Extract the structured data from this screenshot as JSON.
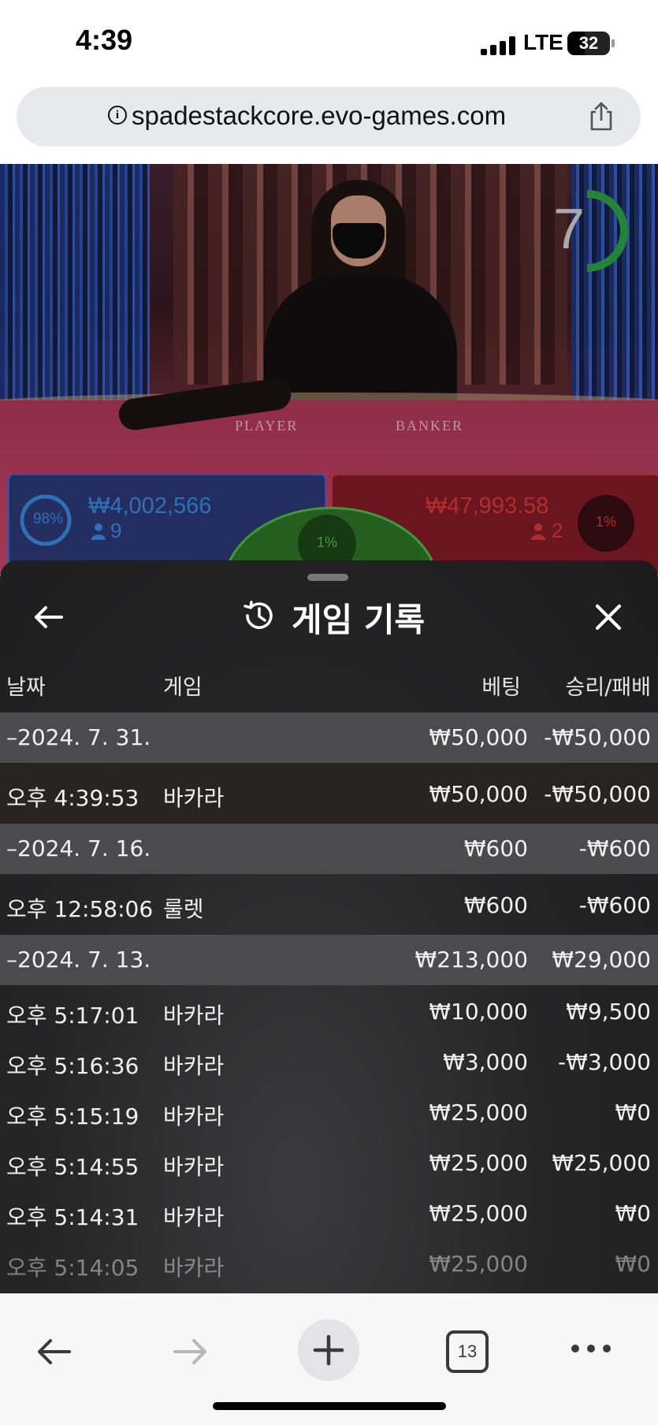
{
  "status_bar": {
    "time": "4:39",
    "network": "LTE",
    "battery": "32"
  },
  "address_bar": {
    "url": "spadestackcore.evo-games.com"
  },
  "game": {
    "timer": "7",
    "felt_player": "PLAYER",
    "felt_banker": "BANKER",
    "player": {
      "percent": "98%",
      "amount": "₩4,002,566",
      "count": "9"
    },
    "banker": {
      "percent": "1%",
      "amount": "₩47,993.58",
      "count": "2"
    },
    "tie": {
      "percent": "1%"
    }
  },
  "history": {
    "title": "게임 기록",
    "columns": {
      "date": "날짜",
      "game": "게임",
      "bet": "베팅",
      "winloss": "승리/패배"
    },
    "rows": [
      {
        "type": "date",
        "date": "–2024. 7. 31.",
        "bet": "₩50,000",
        "winloss": "-₩50,000"
      },
      {
        "type": "item",
        "time": "오후 4:39:53",
        "game": "바카라",
        "bet": "₩50,000",
        "winloss": "-₩50,000"
      },
      {
        "type": "date",
        "date": "–2024. 7. 16.",
        "bet": "₩600",
        "winloss": "-₩600"
      },
      {
        "type": "item",
        "time": "오후 12:58:06",
        "game": "룰렛",
        "bet": "₩600",
        "winloss": "-₩600"
      },
      {
        "type": "date",
        "date": "–2024. 7. 13.",
        "bet": "₩213,000",
        "winloss": "₩29,000"
      },
      {
        "type": "item",
        "time": "오후 5:17:01",
        "game": "바카라",
        "bet": "₩10,000",
        "winloss": "₩9,500"
      },
      {
        "type": "item",
        "time": "오후 5:16:36",
        "game": "바카라",
        "bet": "₩3,000",
        "winloss": "-₩3,000"
      },
      {
        "type": "item",
        "time": "오후 5:15:19",
        "game": "바카라",
        "bet": "₩25,000",
        "winloss": "₩0"
      },
      {
        "type": "item",
        "time": "오후 5:14:55",
        "game": "바카라",
        "bet": "₩25,000",
        "winloss": "₩25,000"
      },
      {
        "type": "item",
        "time": "오후 5:14:31",
        "game": "바카라",
        "bet": "₩25,000",
        "winloss": "₩0"
      },
      {
        "type": "item",
        "time": "오후 5:14:05",
        "game": "바카라",
        "bet": "₩25,000",
        "winloss": "₩0"
      }
    ]
  },
  "toolbar": {
    "tab_count": "13"
  },
  "colors": {
    "player": "#3d8fe8",
    "banker": "#e03a3a",
    "tie": "#53c44a",
    "sheet_bg": "#1f1f20",
    "date_row": "#4b4b4d"
  },
  "icons": [
    "info-icon",
    "share-icon",
    "back-arrow-icon",
    "history-icon",
    "close-icon",
    "user-icon",
    "plus-icon",
    "forward-arrow-icon",
    "tabs-icon",
    "more-icon"
  ]
}
